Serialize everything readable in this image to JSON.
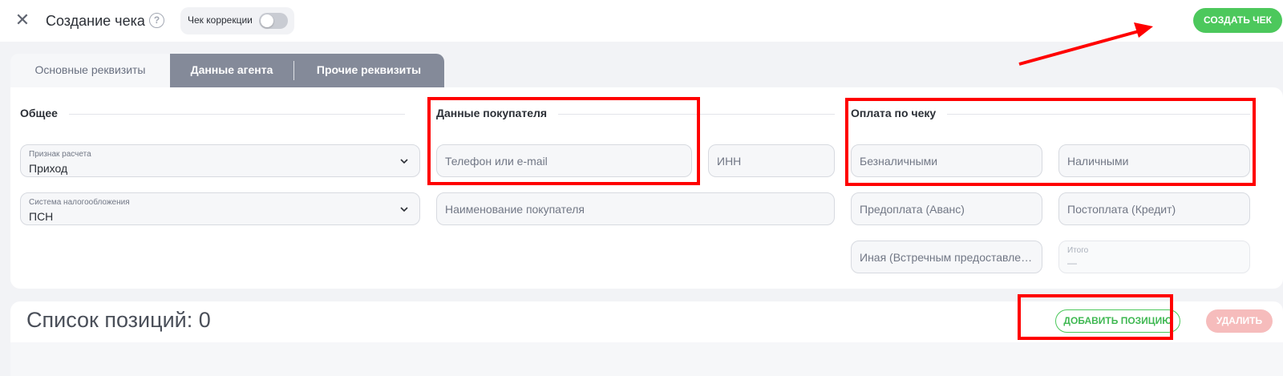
{
  "header": {
    "close_icon": "close-icon",
    "title": "Создание чека",
    "help_icon": "question-circle-icon",
    "help_glyph": "?",
    "correction_label": "Чек коррекции",
    "correction_enabled": false,
    "create_button": "СОЗДАТЬ ЧЕК"
  },
  "tabs": [
    {
      "label": "Основные реквизиты",
      "active": true
    },
    {
      "label": "Данные агента",
      "active": false
    },
    {
      "label": "Прочие реквизиты",
      "active": false
    }
  ],
  "sections": {
    "general": {
      "title": "Общее",
      "settlement": {
        "label": "Признак расчета",
        "value": "Приход"
      },
      "tax_system": {
        "label": "Система налогообложения",
        "value": "ПСН"
      }
    },
    "buyer": {
      "title": "Данные покупателя",
      "phone_placeholder": "Телефон или e-mail",
      "inn_placeholder": "ИНН",
      "name_placeholder": "Наименование покупателя"
    },
    "payment": {
      "title": "Оплата по чеку",
      "cashless_placeholder": "Безналичными",
      "cash_placeholder": "Наличными",
      "prepayment_placeholder": "Предоплата (Аванс)",
      "postpayment_placeholder": "Постоплата (Кредит)",
      "other_placeholder": "Иная (Встречным предоставлен...",
      "total": {
        "label": "Итого",
        "value": "—"
      }
    }
  },
  "positions": {
    "title": "Список позиций: 0",
    "add_button": "ДОБАВИТЬ ПОЗИЦИЮ",
    "delete_button": "УДАЛИТЬ"
  },
  "colors": {
    "accent_green": "#4cc85c",
    "annotation_red": "#ff0000",
    "tab_inactive": "#848a99"
  }
}
